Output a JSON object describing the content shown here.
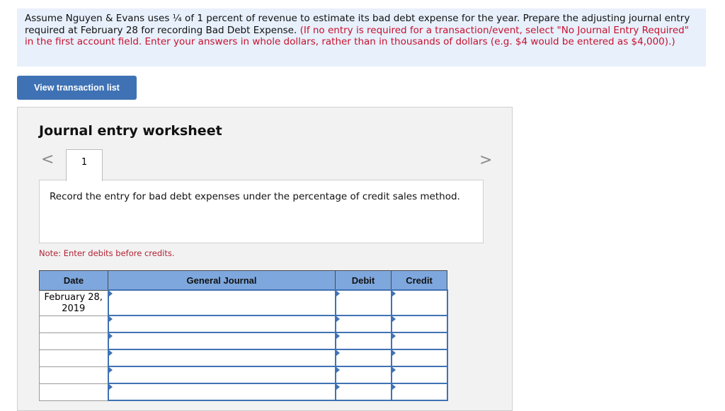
{
  "instructions": {
    "text": "Assume Nguyen & Evans uses ¼ of 1 percent of revenue to estimate its bad debt expense for the year. Prepare the adjusting journal entry required at February 28 for recording Bad Debt Expense.",
    "hint": "(If no entry is required for a transaction/event, select \"No Journal Entry Required\" in the first account field. Enter your answers in whole dollars, rather than in thousands of dollars (e.g. $4 would be entered as $4,000).)"
  },
  "view_transaction_button": "View transaction list",
  "worksheet": {
    "title": "Journal entry worksheet",
    "prev_icon": "chevron-left-icon",
    "next_icon": "chevron-right-icon",
    "active_tab": "1",
    "description": "Record the entry for bad debt expenses under the percentage of credit sales method.",
    "note": "Note: Enter debits before credits.",
    "columns": {
      "date": "Date",
      "general_journal": "General Journal",
      "debit": "Debit",
      "credit": "Credit"
    },
    "first_row_date": "February 28, 2019"
  }
}
